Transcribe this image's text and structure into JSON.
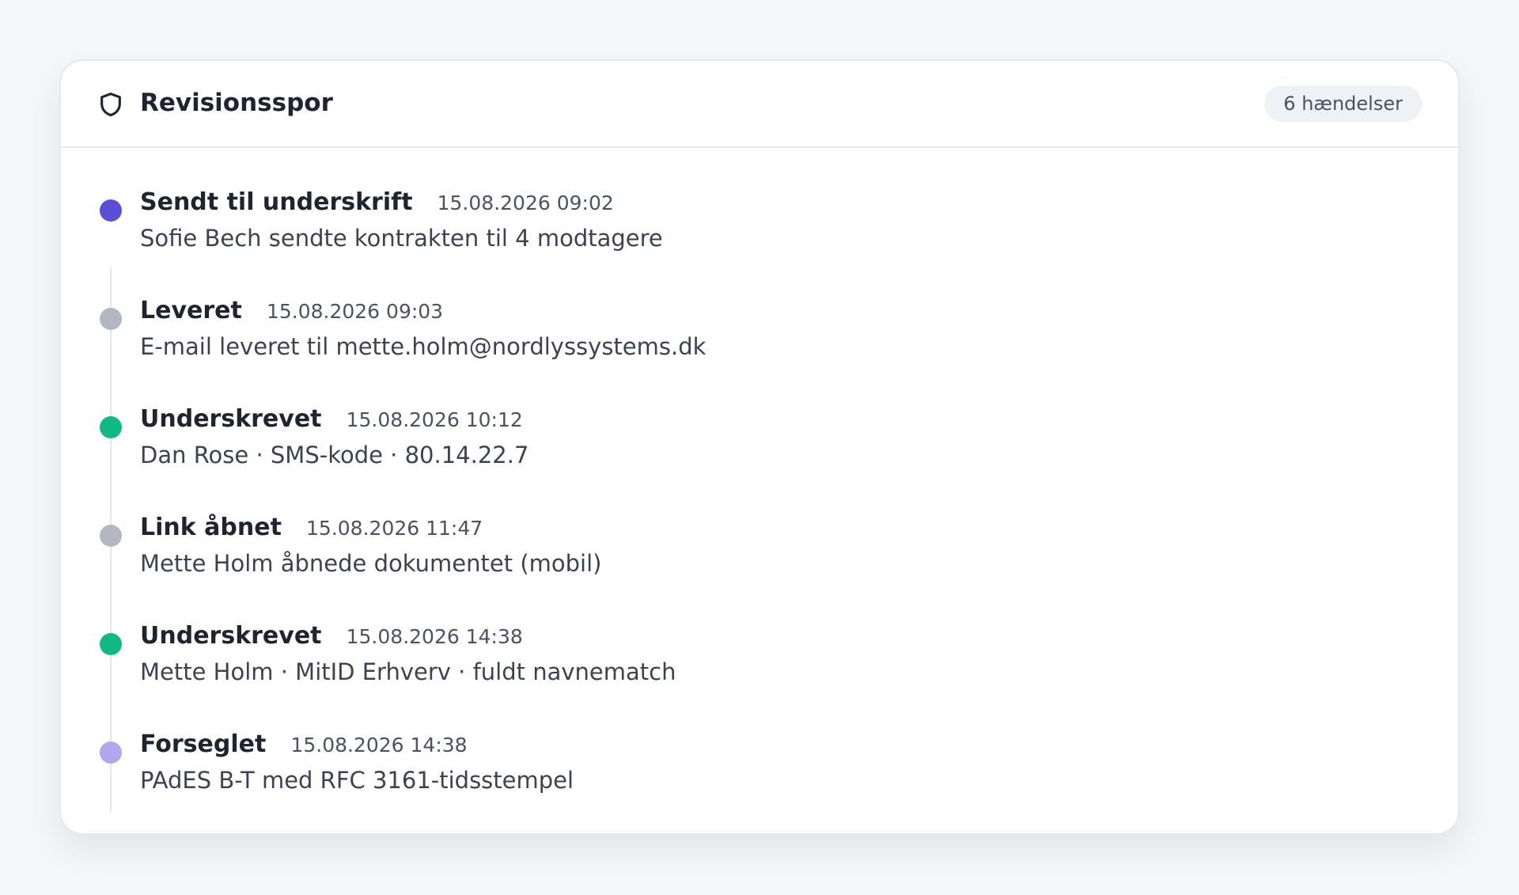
{
  "card": {
    "title": "Revisionsspor",
    "icon": "shield-icon",
    "count_label": "6 hændelser"
  },
  "events": [
    {
      "title": "Sendt til underskrift",
      "time": "15.08.2026 09:02",
      "description": "Sofie Bech sendte kontrakten til 4 modtagere",
      "dot_color": "#5a4fd4"
    },
    {
      "title": "Leveret",
      "time": "15.08.2026 09:03",
      "description": "E-mail leveret til mette.holm@nordlyssystems.dk",
      "dot_color": "#b3b7c0"
    },
    {
      "title": "Underskrevet",
      "time": "15.08.2026 10:12",
      "description": "Dan Rose · SMS-kode · 80.14.22.7",
      "dot_color": "#10b981"
    },
    {
      "title": "Link åbnet",
      "time": "15.08.2026 11:47",
      "description": "Mette Holm åbnede dokumentet (mobil)",
      "dot_color": "#b3b7c0"
    },
    {
      "title": "Underskrevet",
      "time": "15.08.2026 14:38",
      "description": "Mette Holm · MitID Erhverv · fuldt navnematch",
      "dot_color": "#10b981"
    },
    {
      "title": "Forseglet",
      "time": "15.08.2026 14:38",
      "description": "PAdES B-T med RFC 3161-tidsstempel",
      "dot_color": "#b3a6ec"
    }
  ]
}
